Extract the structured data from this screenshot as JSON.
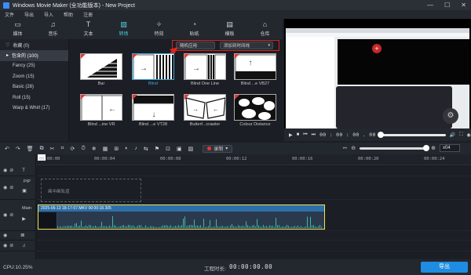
{
  "titlebar": {
    "title": "Windows Movie Maker (全功能版本) - New Project",
    "minimize": "—",
    "maximize": "☐",
    "close": "✕"
  },
  "menubar": [
    "文件",
    "导出",
    "导入",
    "帮助",
    "注册"
  ],
  "category_tabs": [
    {
      "label": "媒体",
      "icon": "folder-icon"
    },
    {
      "label": "音乐",
      "icon": "music-icon"
    },
    {
      "label": "文本",
      "icon": "text-icon"
    },
    {
      "label": "转场",
      "icon": "transition-icon",
      "active": true
    },
    {
      "label": "特效",
      "icon": "effects-icon"
    },
    {
      "label": "贴纸",
      "icon": "sticker-icon"
    },
    {
      "label": "横板",
      "icon": "layout-icon"
    },
    {
      "label": "仓库",
      "icon": "store-icon"
    }
  ],
  "transition_categories": {
    "favorite": "收藏 (0)",
    "items": [
      "包含的 (100)",
      "Fancy (25)",
      "Zoom (15)",
      "Basic (28)",
      "Roll (15)",
      "Warp & Whirl (17)"
    ],
    "active_index": 0
  },
  "toolbar_controls": {
    "random_apply": "随机应用",
    "add_to_timeline": "添加到时间线"
  },
  "transitions": [
    {
      "label": "Bar"
    },
    {
      "label": "Blind",
      "selected": true
    },
    {
      "label": "Blind One Line"
    },
    {
      "label": "Blind ...e VB27"
    },
    {
      "label": "Blind ...ine VR"
    },
    {
      "label": "Blind ...e VT28"
    },
    {
      "label": "Butterf...crawler"
    },
    {
      "label": "Colour Distance"
    }
  ],
  "player": {
    "time": "00 : 00 : 00 . 00",
    "progress": 0
  },
  "timeline_toolbar": {
    "record_label": "录制",
    "zoom_value": "x04",
    "zoom_level": 1
  },
  "ruler": [
    "00:00:00",
    "00:00:04",
    "00:00:08",
    "00:00:12",
    "00:00:16",
    "00:00:20",
    "00:00:24"
  ],
  "tracks": {
    "pip_label": "PIP",
    "pip_drop_text": "画中画轨道",
    "main_label": "Main",
    "clip_title": "2025-06-13 18-17-07.MKV    00:00:18.305"
  },
  "status": {
    "cpu": "CPU:10.25%",
    "duration_label": "工程时长:",
    "duration": "00:00:00.00",
    "export": "导出"
  }
}
